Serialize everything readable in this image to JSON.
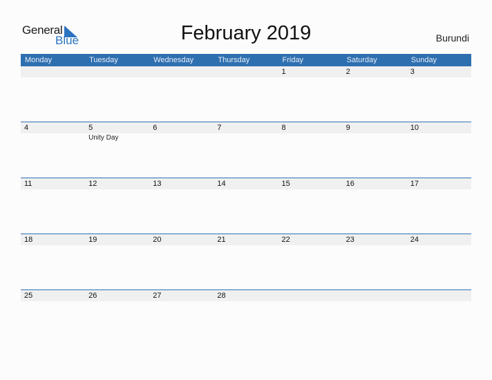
{
  "logo": {
    "general": "General",
    "blue": "Blue"
  },
  "title": "February 2019",
  "country": "Burundi",
  "colors": {
    "accent": "#2e6fb0",
    "strip": "#f0f0f0"
  },
  "weekdays": [
    "Monday",
    "Tuesday",
    "Wednesday",
    "Thursday",
    "Friday",
    "Saturday",
    "Sunday"
  ],
  "weeks": [
    {
      "days": [
        "",
        "",
        "",
        "",
        "1",
        "2",
        "3"
      ],
      "events": [
        "",
        "",
        "",
        "",
        "",
        "",
        ""
      ]
    },
    {
      "days": [
        "4",
        "5",
        "6",
        "7",
        "8",
        "9",
        "10"
      ],
      "events": [
        "",
        "Unity Day",
        "",
        "",
        "",
        "",
        ""
      ]
    },
    {
      "days": [
        "11",
        "12",
        "13",
        "14",
        "15",
        "16",
        "17"
      ],
      "events": [
        "",
        "",
        "",
        "",
        "",
        "",
        ""
      ]
    },
    {
      "days": [
        "18",
        "19",
        "20",
        "21",
        "22",
        "23",
        "24"
      ],
      "events": [
        "",
        "",
        "",
        "",
        "",
        "",
        ""
      ]
    },
    {
      "days": [
        "25",
        "26",
        "27",
        "28",
        "",
        "",
        ""
      ],
      "events": [
        "",
        "",
        "",
        "",
        "",
        "",
        ""
      ]
    }
  ]
}
